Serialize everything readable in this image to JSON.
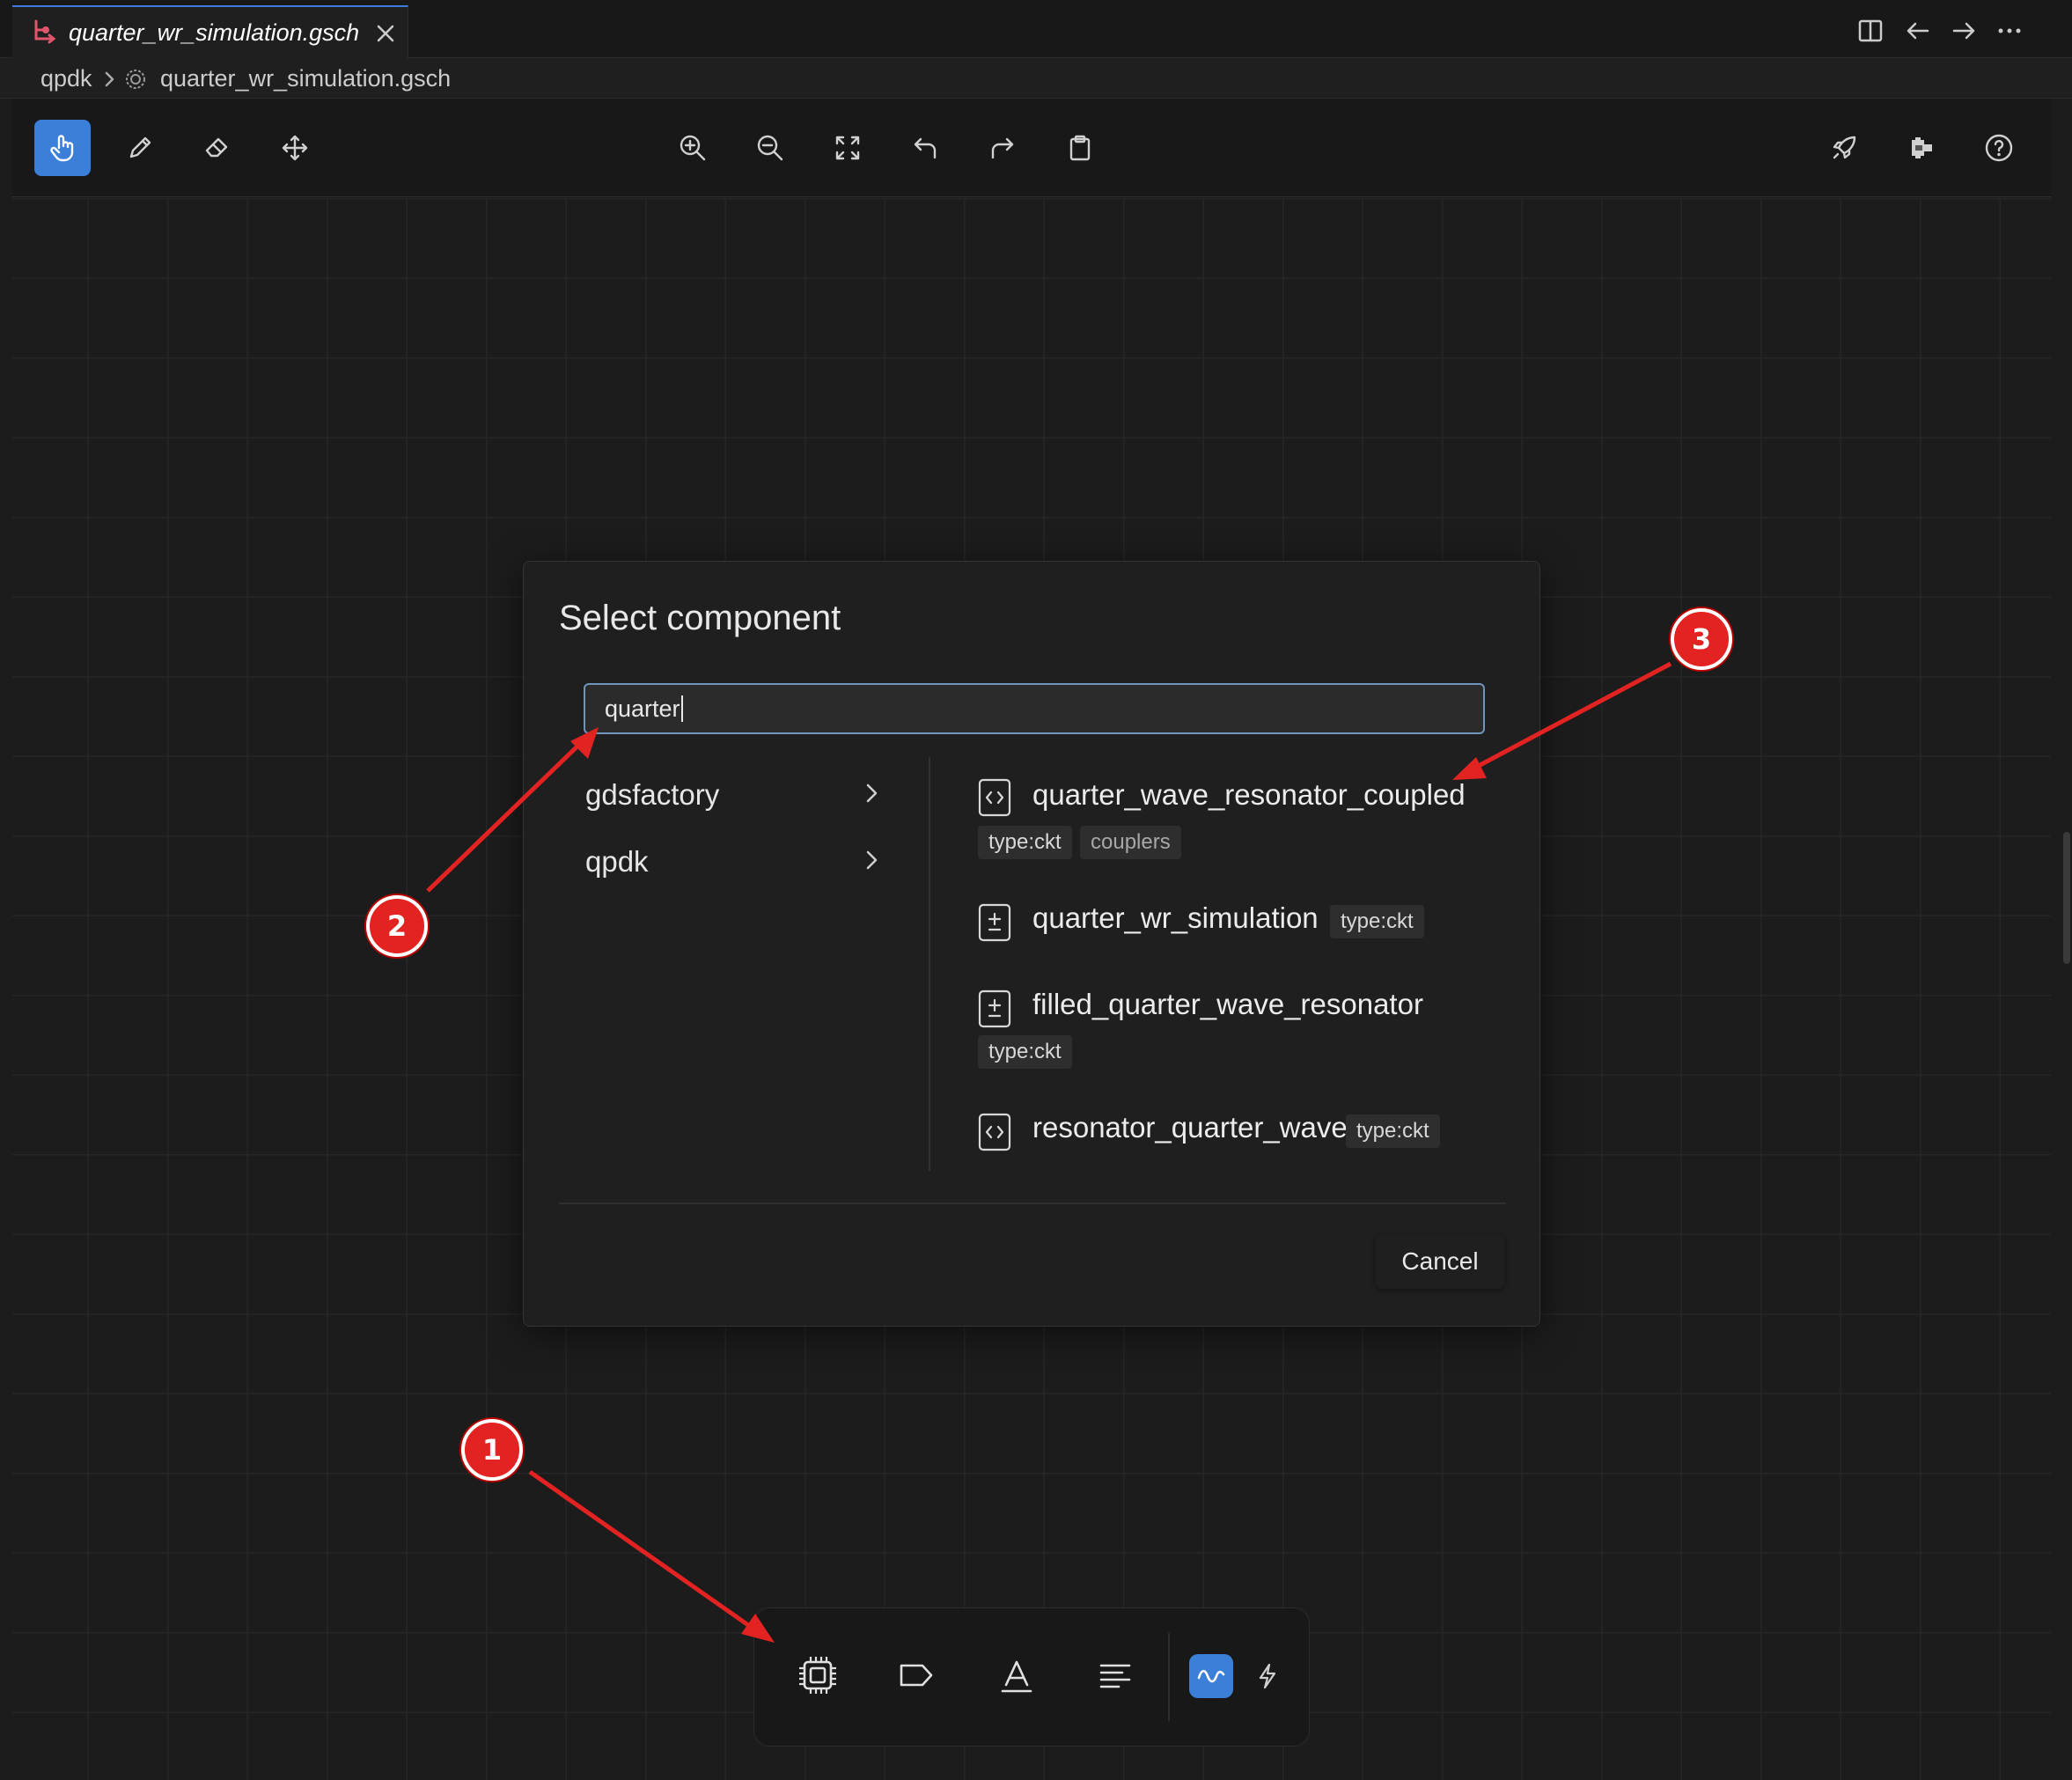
{
  "tab": {
    "title": "quarter_wr_simulation.gsch",
    "icon": "schematic-file-icon"
  },
  "breadcrumb": {
    "root": "qpdk",
    "file": "quarter_wr_simulation.gsch"
  },
  "toolbar": {
    "left_tools": [
      "hand-pointer",
      "pencil",
      "eraser",
      "move"
    ],
    "center_tools": [
      "zoom-in",
      "zoom-out",
      "fit-view",
      "undo",
      "redo",
      "clipboard"
    ],
    "right_tools": [
      "rocket",
      "component-panel",
      "help"
    ],
    "active_tool": "hand-pointer"
  },
  "dialog": {
    "title": "Select component",
    "search_value": "quarter",
    "libraries": [
      {
        "label": "gdsfactory"
      },
      {
        "label": "qpdk"
      }
    ],
    "results": [
      {
        "name": "quarter_wave_resonator_coupled",
        "icon": "code-icon",
        "tags": [
          "type:ckt",
          "couplers"
        ]
      },
      {
        "name": "quarter_wr_simulation",
        "icon": "plus-minus-icon",
        "tags": [
          "type:ckt"
        ]
      },
      {
        "name": "filled_quarter_wave_resonator",
        "icon": "plus-minus-icon",
        "tags": [
          "type:ckt"
        ]
      },
      {
        "name": "resonator_quarter_wave",
        "icon": "code-icon",
        "tags": [
          "type:ckt"
        ]
      }
    ],
    "cancel_label": "Cancel"
  },
  "dock": {
    "items": [
      "chip",
      "label-tag",
      "text",
      "align-left",
      "waveform",
      "lightning"
    ],
    "active_item": "waveform"
  },
  "annotations": [
    {
      "number": "1"
    },
    {
      "number": "2"
    },
    {
      "number": "3"
    }
  ],
  "colors": {
    "accent": "#3c7fd8",
    "annotation": "#e32222",
    "background": "#1c1c1c"
  }
}
